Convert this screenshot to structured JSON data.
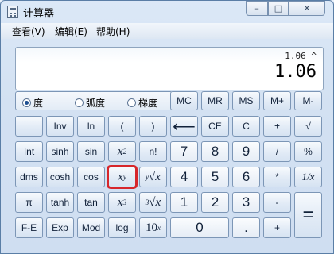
{
  "window": {
    "title": "计算器",
    "min_symbol": "–",
    "max_symbol": "□",
    "close_symbol": "✕"
  },
  "menu": {
    "items": [
      "查看(V)",
      "编辑(E)",
      "帮助(H)"
    ]
  },
  "display": {
    "expression": "1.06 ^",
    "value": "1.06"
  },
  "angle_mode": {
    "options": [
      "度",
      "弧度",
      "梯度"
    ],
    "selected": "度"
  },
  "memory_buttons": [
    "MC",
    "MR",
    "MS",
    "M+",
    "M-"
  ],
  "buttons": {
    "inv": "Inv",
    "ln": "ln",
    "lparen": "(",
    "rparen": ")",
    "backspace": "⟵",
    "ce": "CE",
    "c": "C",
    "plusminus": "±",
    "sqrt": "√",
    "int": "Int",
    "sinh": "sinh",
    "sin": "sin",
    "x2_base": "x",
    "x2_exp": "2",
    "fact": "n!",
    "seven": "7",
    "eight": "8",
    "nine": "9",
    "divide": "/",
    "percent": "%",
    "dms": "dms",
    "cosh": "cosh",
    "cos": "cos",
    "xy_base": "x",
    "xy_exp": "y",
    "yroot_index": "y",
    "yroot_sign": "√",
    "yroot_x": "x",
    "four": "4",
    "five": "5",
    "six": "6",
    "multiply": "*",
    "reciprocal": "1/x",
    "pi": "π",
    "tanh": "tanh",
    "tan": "tan",
    "x3_base": "x",
    "x3_exp": "3",
    "cbrt_index": "3",
    "cbrt_sign": "√",
    "cbrt_x": "x",
    "one": "1",
    "two": "2",
    "three": "3",
    "minus": "-",
    "equals": "=",
    "fe": "F-E",
    "exp": "Exp",
    "mod": "Mod",
    "log": "log",
    "ten_base": "10",
    "ten_exp": "x",
    "zero": "0",
    "dot": ".",
    "plus": "+"
  }
}
